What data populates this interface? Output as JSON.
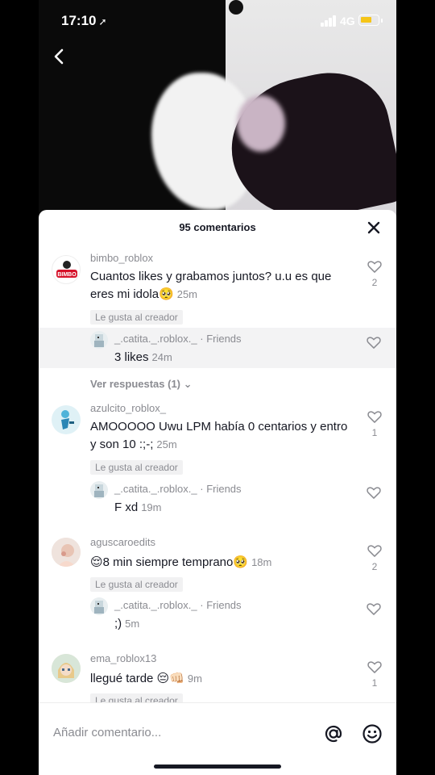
{
  "status_bar": {
    "time": "17:10",
    "network": "4G"
  },
  "panel": {
    "title": "95 comentarios"
  },
  "comments": [
    {
      "username": "bimbo_roblox",
      "text": "Cuantos likes y grabamos juntos? u.u es que eres mi idola🥺",
      "time": "25m",
      "badge": "Le gusta al creador",
      "likes": "2",
      "avatar_logo": "BIMBO",
      "reply": {
        "username": "_.catita._.roblox._",
        "tag": "· Friends",
        "text": "3 likes",
        "time": "24m"
      },
      "view_replies": "Ver respuestas (1)"
    },
    {
      "username": "azulcito_roblox_",
      "text": "AMOOOOO Uwu LPM había 0 centarios y entro y son 10 :;-;",
      "time": "25m",
      "badge": "Le gusta al creador",
      "likes": "1",
      "reply": {
        "username": "_.catita._.roblox._",
        "tag": "· Friends",
        "text": "F xd",
        "time": "19m"
      }
    },
    {
      "username": "aguscaroedits",
      "text": "😌8 min siempre temprano🥺",
      "time": "18m",
      "badge": "Le gusta al creador",
      "likes": "2",
      "reply": {
        "username": "_.catita._.roblox._",
        "tag": "· Friends",
        "text": ";)",
        "time": "5m"
      }
    },
    {
      "username": "ema_roblox13",
      "text": "llegué tarde 😔👊🏻",
      "time": "9m",
      "badge": "Le gusta al creador",
      "likes": "1"
    }
  ],
  "input": {
    "placeholder": "Añadir comentario..."
  },
  "colors": {
    "battery": "#f5c518",
    "text_primary": "#161823",
    "text_secondary": "#8a8b91"
  }
}
